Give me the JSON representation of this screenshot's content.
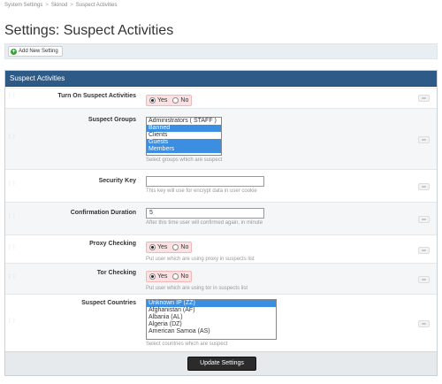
{
  "breadcrumb": {
    "items": [
      "System Settings",
      "Skinod",
      "Suspect Activities"
    ],
    "separator": ">"
  },
  "page": {
    "title": "Settings: Suspect Activities"
  },
  "toolbar": {
    "add_label": "Add New Setting"
  },
  "panel": {
    "title": "Suspect Activities"
  },
  "settings": {
    "turn_on": {
      "label": "Turn On Suspect Activities",
      "yes": "Yes",
      "no": "No",
      "value": "Yes"
    },
    "groups": {
      "label": "Suspect Groups",
      "options": [
        "Administrators ( STAFF )",
        "Banned",
        "Clients",
        "Guests",
        "Members"
      ],
      "selected": [
        "Banned",
        "Guests",
        "Members"
      ],
      "hint": "Select groups which are suspect"
    },
    "security_key": {
      "label": "Security Key",
      "value": "",
      "hint": "This key will use for encrypt data in user cookie"
    },
    "confirmation": {
      "label": "Confirmation Duration",
      "value": "5",
      "hint": "After this time user will confirmed again, in minute"
    },
    "proxy": {
      "label": "Proxy Checking",
      "yes": "Yes",
      "no": "No",
      "value": "Yes",
      "hint": "Put user which are using proxy in suspects list"
    },
    "tor": {
      "label": "Tor Checking",
      "yes": "Yes",
      "no": "No",
      "value": "Yes",
      "hint": "Put user which are using tor in suspects list"
    },
    "countries": {
      "label": "Suspect Countries",
      "options": [
        "Unknown IP (ZZ)",
        "Afghanistan (AF)",
        "Albania (AL)",
        "Algeria (DZ)",
        "American Samoa (AS)"
      ],
      "selected": [
        "Unknown IP (ZZ)"
      ],
      "hint": "Select countries which are suspect"
    }
  },
  "footer": {
    "update_label": "Update Settings"
  },
  "colors": {
    "header": "#2d5a86",
    "selected": "#3b8ee0",
    "yesno_bg": "#fbe1e1"
  }
}
